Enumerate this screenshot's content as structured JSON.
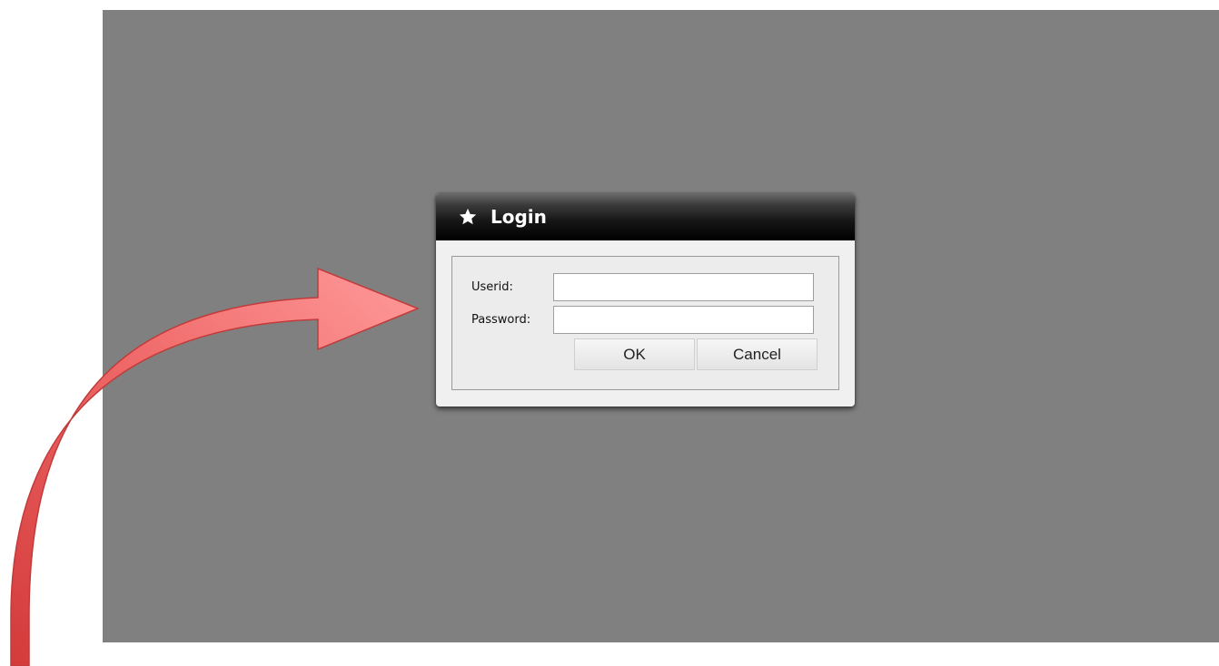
{
  "dialog": {
    "title": "Login",
    "title_icon": "star-icon",
    "userid_label": "Userid:",
    "userid_value": "",
    "password_label": "Password:",
    "password_value": "",
    "ok_label": "OK",
    "cancel_label": "Cancel"
  },
  "colors": {
    "backdrop": "#808080",
    "annotation_arrow": "#e85a5a",
    "titlebar": "#000000"
  },
  "annotation": {
    "arrow_icon": "curved-arrow-icon"
  }
}
